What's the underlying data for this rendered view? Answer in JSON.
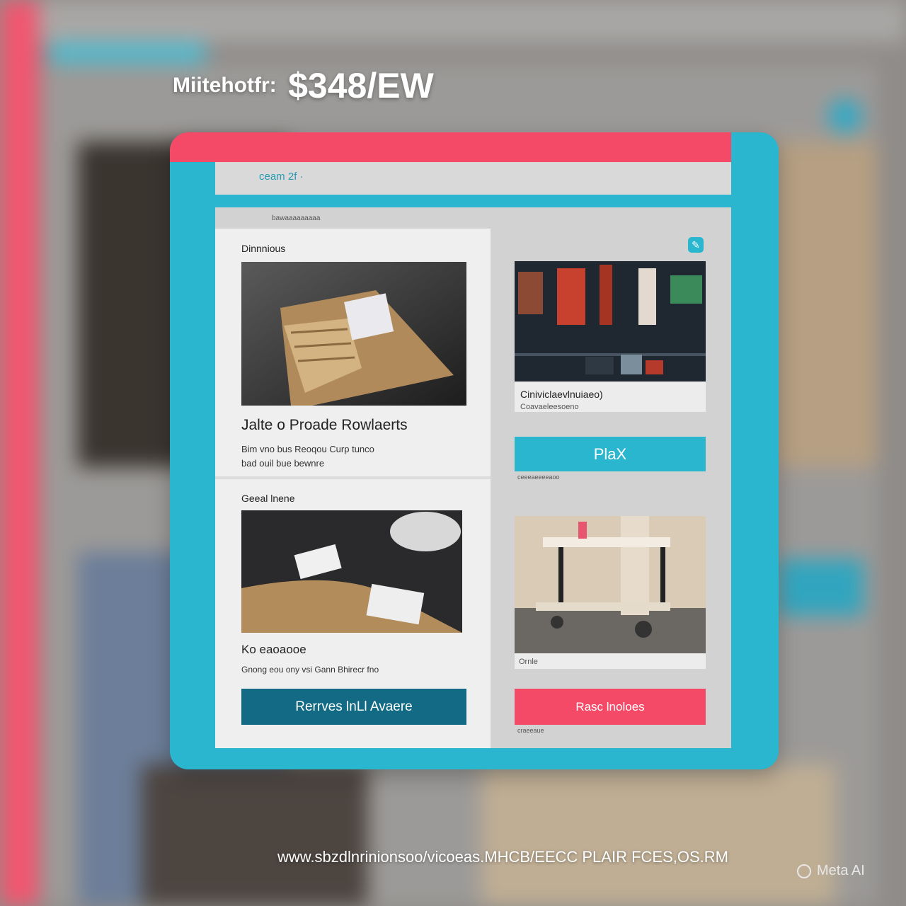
{
  "headline": {
    "label": "Miitehotfr:",
    "price": "$348/EW"
  },
  "browser": {
    "address": "ceam 2f ·"
  },
  "inner": {
    "caption": "bawaaaaaaaaa"
  },
  "left_column": {
    "section1_label": "Dinnnious",
    "product_title": "Jalte o Proade Rowlaerts",
    "product_desc_line1": "Bim vno bus Reoqou Curp tunco",
    "product_desc_line2": "bad ouil bue bewnre",
    "section2_label": "Geeal lnene",
    "item_title": "Ko eaoaooe",
    "item_desc": "Gnong eou ony vsi Gann Bhirecr fno",
    "primary_button": "Rerrves lnLl Avaere"
  },
  "right_column": {
    "card1_title": "Ciniviclaevlnuiaeo)",
    "card1_subtitle": "Coavaeleesoeno",
    "cta_button": "PlaX",
    "cta_caption": "ceeeaeeeeaoo",
    "card2_caption": "Ornle",
    "secondary_button": "Rasc lnoloes",
    "secondary_caption": "craeeaue",
    "badge_icon": "edit-icon"
  },
  "footer": {
    "url": "www.sbzdlnrinionsoo/vicoeas.MHCB/EECC PLAIR FCES,OS.RM"
  },
  "watermark": {
    "text": "Meta AI"
  },
  "colors": {
    "accent_cyan": "#2bb6cf",
    "accent_pink": "#f44a67",
    "dark_teal_button": "#126a85"
  }
}
